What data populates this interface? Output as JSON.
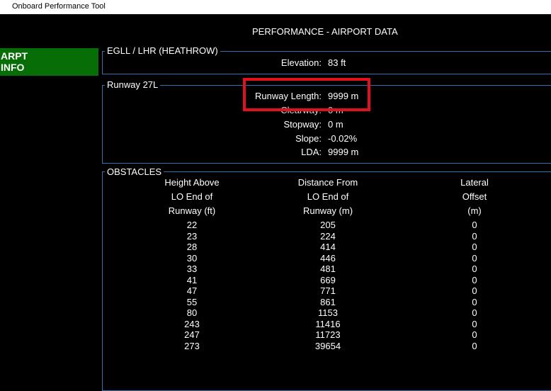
{
  "window": {
    "title": "Onboard Performance Tool"
  },
  "page_title": "PERFORMANCE - AIRPORT DATA",
  "sidebar": {
    "button_line1": "ARPT",
    "button_line2": "INFO"
  },
  "airport": {
    "legend": "EGLL / LHR (HEATHROW)",
    "elevation_label": "Elevation:",
    "elevation_value": "83 ft"
  },
  "runway": {
    "legend": "Runway 27L",
    "fields": [
      {
        "label": "Runway Length:",
        "value": "9999 m"
      },
      {
        "label": "Clearway:",
        "value": "0 m"
      },
      {
        "label": "Stopway:",
        "value": "0 m"
      },
      {
        "label": "Slope:",
        "value": "-0.02%"
      },
      {
        "label": "LDA:",
        "value": "9999 m"
      }
    ]
  },
  "obstacles": {
    "legend": "OBSTACLES",
    "headers": [
      [
        "Height Above",
        "LO End of",
        "Runway (ft)"
      ],
      [
        "Distance From",
        "LO End of",
        "Runway (m)"
      ],
      [
        "Lateral",
        "Offset",
        "(m)"
      ]
    ],
    "rows": [
      [
        "22",
        "205",
        "0"
      ],
      [
        "23",
        "224",
        "0"
      ],
      [
        "28",
        "414",
        "0"
      ],
      [
        "30",
        "446",
        "0"
      ],
      [
        "33",
        "481",
        "0"
      ],
      [
        "41",
        "669",
        "0"
      ],
      [
        "47",
        "771",
        "0"
      ],
      [
        "55",
        "861",
        "0"
      ],
      [
        "80",
        "1153",
        "0"
      ],
      [
        "243",
        "11416",
        "0"
      ],
      [
        "247",
        "11723",
        "0"
      ],
      [
        "273",
        "39654",
        "0"
      ]
    ]
  },
  "colors": {
    "background": "#000000",
    "panel_border": "#2f75b5",
    "button_green": "#076e07",
    "highlight_red": "#e3101d"
  }
}
